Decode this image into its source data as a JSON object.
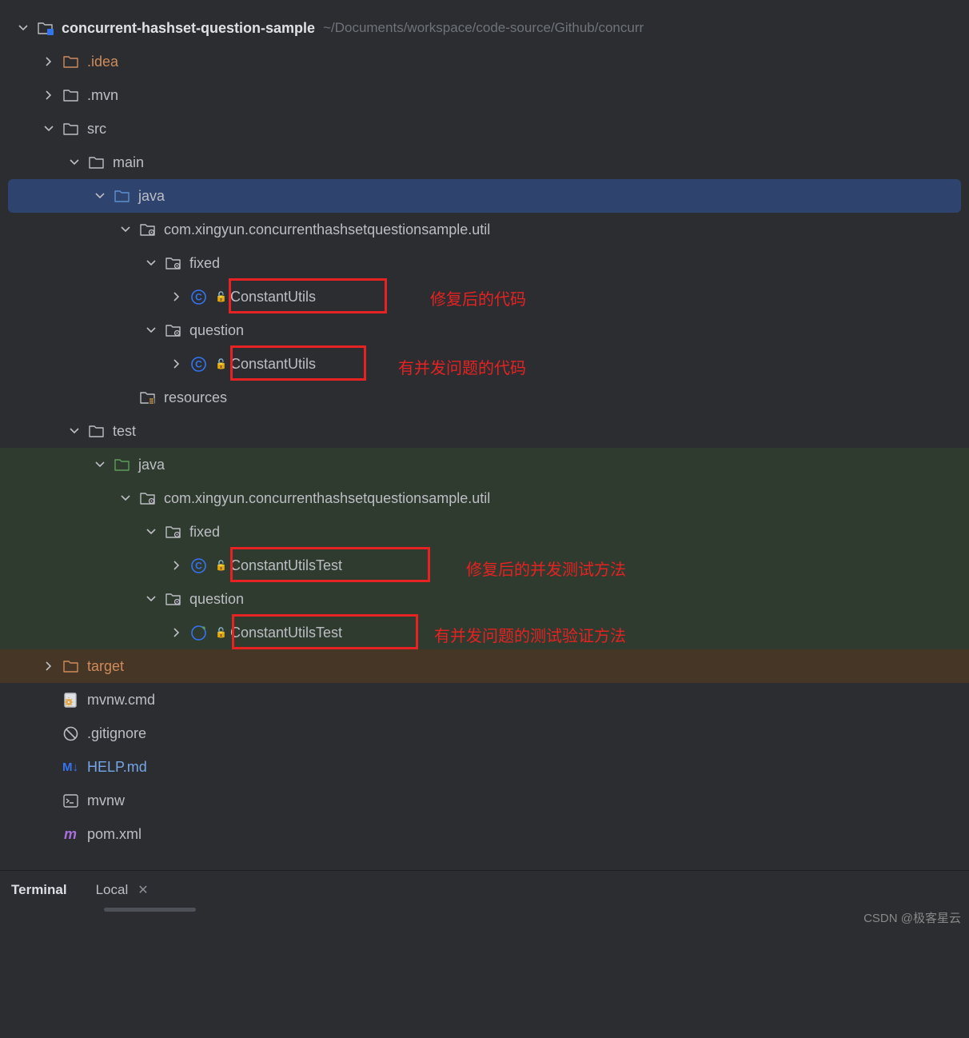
{
  "root": {
    "name": "concurrent-hashset-question-sample",
    "path": "~/Documents/workspace/code-source/Github/concurr"
  },
  "folders": {
    "idea": ".idea",
    "mvn": ".mvn",
    "src": "src",
    "main": "main",
    "java1": "java",
    "pkg1": "com.xingyun.concurrenthashsetquestionsample.util",
    "fixed1": "fixed",
    "class1": "ConstantUtils",
    "question1": "question",
    "class2": "ConstantUtils",
    "resources": "resources",
    "test": "test",
    "java2": "java",
    "pkg2": "com.xingyun.concurrenthashsetquestionsample.util",
    "fixed2": "fixed",
    "class3": "ConstantUtilsTest",
    "question2": "question",
    "class4": "ConstantUtilsTest",
    "target": "target",
    "mvnwcmd": "mvnw.cmd",
    "gitignore": ".gitignore",
    "help": "HELP.md",
    "mvnw": "mvnw",
    "pom": "pom.xml"
  },
  "annotations": {
    "a1": "修复后的代码",
    "a2": "有并发问题的代码",
    "a3": "修复后的并发测试方法",
    "a4": "有并发问题的测试验证方法"
  },
  "footer": {
    "terminal": "Terminal",
    "tab": "Local"
  },
  "watermark": "CSDN @极客星云"
}
